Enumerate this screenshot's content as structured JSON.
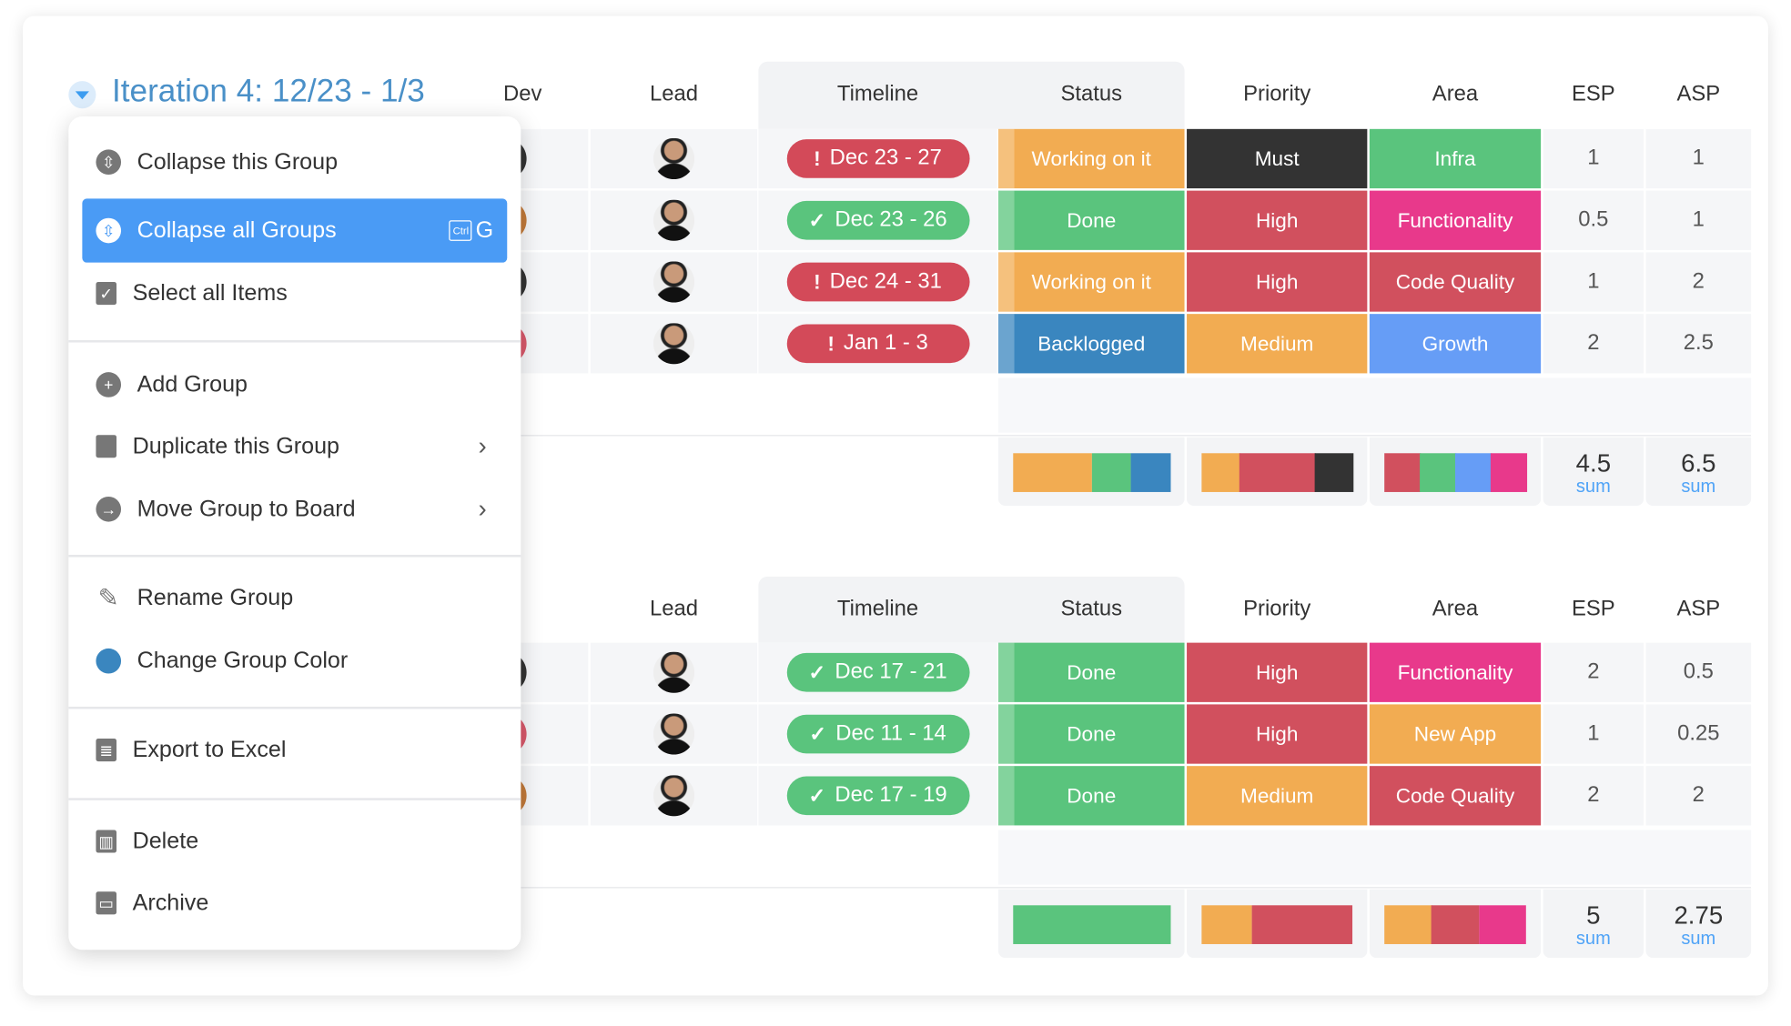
{
  "group1": {
    "title": "Iteration 4: 12/23 - 1/3",
    "color": "#4a90c8",
    "headers": {
      "dev": "Dev",
      "lead": "Lead",
      "timeline": "Timeline",
      "status": "Status",
      "priority": "Priority",
      "area": "Area",
      "esp": "ESP",
      "asp": "ASP"
    },
    "rows": [
      {
        "timeline": "Dec 23 - 27",
        "timeline_state": "overdue",
        "status": "Working on it",
        "priority": "Must",
        "area": "Infra",
        "esp": "1",
        "asp": "1",
        "dev_color": "#333333"
      },
      {
        "timeline": "Dec 23 - 26",
        "timeline_state": "done",
        "status": "Done",
        "priority": "High",
        "area": "Functionality",
        "esp": "0.5",
        "asp": "1",
        "dev_color": "#c27a3a"
      },
      {
        "timeline": "Dec 24 - 31",
        "timeline_state": "overdue",
        "status": "Working on it",
        "priority": "High",
        "area": "Code Quality",
        "esp": "1",
        "asp": "2",
        "dev_color": "#333333"
      },
      {
        "timeline": "Jan 1 - 3",
        "timeline_state": "overdue",
        "status": "Backlogged",
        "priority": "Medium",
        "area": "Growth",
        "esp": "2",
        "asp": "2.5",
        "dev_color": "#d9596b"
      }
    ],
    "summary": {
      "status": [
        {
          "label": "Working on it",
          "fraction": 0.5
        },
        {
          "label": "Done",
          "fraction": 0.25
        },
        {
          "label": "Backlogged",
          "fraction": 0.25
        }
      ],
      "priority": [
        {
          "label": "Medium",
          "fraction": 0.25
        },
        {
          "label": "High",
          "fraction": 0.5
        },
        {
          "label": "Must",
          "fraction": 0.25
        }
      ],
      "area": [
        {
          "label": "Code Quality",
          "fraction": 0.25
        },
        {
          "label": "Infra",
          "fraction": 0.25
        },
        {
          "label": "Growth",
          "fraction": 0.25
        },
        {
          "label": "Functionality",
          "fraction": 0.25
        }
      ],
      "esp": "4.5",
      "asp": "6.5",
      "esp_label": "sum",
      "asp_label": "sum"
    }
  },
  "group2": {
    "headers": {
      "lead": "Lead",
      "timeline": "Timeline",
      "status": "Status",
      "priority": "Priority",
      "area": "Area",
      "esp": "ESP",
      "asp": "ASP"
    },
    "rows": [
      {
        "timeline": "Dec 17 - 21",
        "timeline_state": "done",
        "status": "Done",
        "priority": "High",
        "area": "Functionality",
        "esp": "2",
        "asp": "0.5",
        "dev_color": "#333333"
      },
      {
        "timeline": "Dec 11 - 14",
        "timeline_state": "done",
        "status": "Done",
        "priority": "High",
        "area": "New App",
        "esp": "1",
        "asp": "0.25",
        "dev_color": "#d9596b"
      },
      {
        "timeline": "Dec 17 - 19",
        "timeline_state": "done",
        "status": "Done",
        "priority": "Medium",
        "area": "Code Quality",
        "esp": "2",
        "asp": "2",
        "dev_color": "#c27a3a"
      }
    ],
    "summary": {
      "status": [
        {
          "label": "Done",
          "fraction": 1
        }
      ],
      "priority": [
        {
          "label": "Medium",
          "fraction": 0.333
        },
        {
          "label": "High",
          "fraction": 0.667
        }
      ],
      "area": [
        {
          "label": "New App",
          "fraction": 0.333
        },
        {
          "label": "Code Quality",
          "fraction": 0.333
        },
        {
          "label": "Functionality",
          "fraction": 0.334
        }
      ],
      "esp": "5",
      "asp": "2.75",
      "esp_label": "sum",
      "asp_label": "sum"
    }
  },
  "label_colors": {
    "Working on it": "#f2ac52",
    "Done": "#5ac47d",
    "Backlogged": "#3a86bf",
    "Must": "#333333",
    "High": "#d1505e",
    "Medium": "#f2ac52",
    "Infra": "#5ac47d",
    "Functionality": "#e8398b",
    "Code Quality": "#d1505e",
    "Growth": "#669df6",
    "New App": "#f2ac52"
  },
  "timeline_colors": {
    "overdue": "#d34a59",
    "done": "#5ac47d"
  },
  "menu": {
    "items": [
      {
        "label": "Collapse this Group",
        "icon": "collapse-icon"
      },
      {
        "label": "Collapse all Groups",
        "icon": "collapse-icon",
        "shortcut_key": "Ctrl",
        "shortcut_letter": "G",
        "active": true
      },
      {
        "label": "Select all Items",
        "icon": "checkbox-icon"
      },
      {
        "label": "Add Group",
        "icon": "plus-circle-icon"
      },
      {
        "label": "Duplicate this Group",
        "icon": "duplicate-icon",
        "submenu": true
      },
      {
        "label": "Move Group to Board",
        "icon": "arrow-right-circle-icon",
        "submenu": true
      },
      {
        "label": "Rename Group",
        "icon": "pencil-icon"
      },
      {
        "label": "Change Group Color",
        "icon": "color-dot-icon"
      },
      {
        "label": "Export to Excel",
        "icon": "excel-file-icon"
      },
      {
        "label": "Delete",
        "icon": "trash-icon"
      },
      {
        "label": "Archive",
        "icon": "archive-icon"
      }
    ],
    "accent": "#4a9bf5",
    "group_color": "#3a86bf"
  }
}
